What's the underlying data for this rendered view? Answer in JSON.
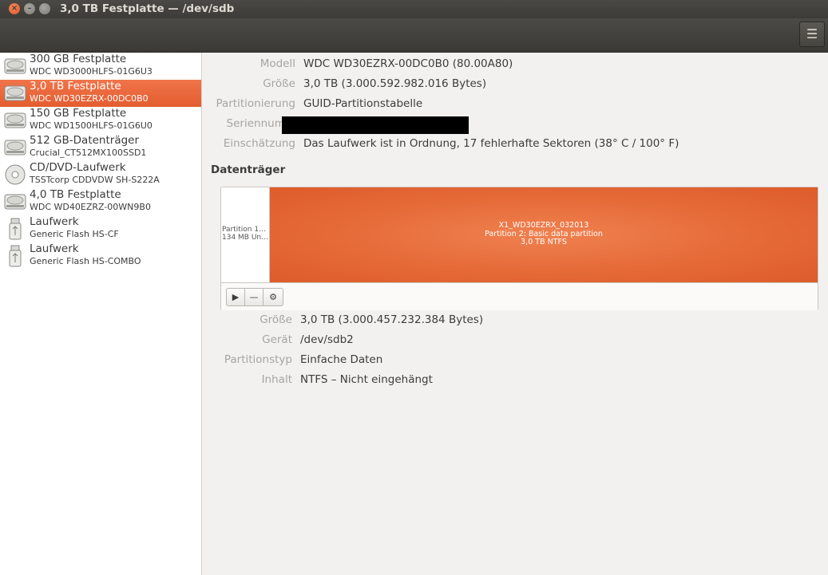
{
  "window": {
    "title": "3,0 TB Festplatte — /dev/sdb",
    "close_glyph": "×",
    "min_glyph": "–",
    "menu_glyph": "☰"
  },
  "sidebar": {
    "items": [
      {
        "name": "300 GB Festplatte",
        "model": "WDC WD3000HLFS-01G6U3",
        "icon": "hard-disk-icon"
      },
      {
        "name": "3,0 TB Festplatte",
        "model": "WDC WD30EZRX-00DC0B0",
        "icon": "hard-disk-icon"
      },
      {
        "name": "150 GB Festplatte",
        "model": "WDC WD1500HLFS-01G6U0",
        "icon": "hard-disk-icon"
      },
      {
        "name": "512 GB-Datenträger",
        "model": "Crucial_CT512MX100SSD1",
        "icon": "hard-disk-icon"
      },
      {
        "name": "CD/DVD-Laufwerk",
        "model": "TSSTcorp CDDVDW SH-S222A",
        "icon": "optical-disc-icon"
      },
      {
        "name": "4,0 TB Festplatte",
        "model": "WDC WD40EZRZ-00WN9B0",
        "icon": "hard-disk-icon"
      },
      {
        "name": "Laufwerk",
        "model": "Generic Flash HS-CF",
        "icon": "usb-drive-icon"
      },
      {
        "name": "Laufwerk",
        "model": "Generic Flash HS-COMBO",
        "icon": "usb-drive-icon"
      }
    ],
    "selected_index": 1
  },
  "drive_info": {
    "model_label": "Modell",
    "model_value": "WDC WD30EZRX-00DC0B0 (80.00A80)",
    "size_label": "Größe",
    "size_value": "3,0 TB (3.000.592.982.016 Bytes)",
    "partitioning_label": "Partitionierung",
    "partitioning_value": "GUID-Partitionstabelle",
    "serial_label": "Seriennumm",
    "assessment_label": "Einschätzung",
    "assessment_value": "Das Laufwerk ist in Ordnung, 17 fehlerhafte Sektoren (38° C / 100° F)"
  },
  "volumes": {
    "heading": "Datenträger",
    "partition1": {
      "line1": "Partition 1…",
      "line2": "134 MB Un…"
    },
    "partition2": {
      "line1": "X1_WD30EZRX_032013",
      "line2": "Partition 2: Basic data partition",
      "line3": "3,0 TB NTFS"
    },
    "buttons": {
      "mount_glyph": "▶",
      "delete_glyph": "—",
      "settings_glyph": "⚙"
    }
  },
  "partition_info": {
    "size_label": "Größe",
    "size_value": "3,0 TB (3.000.457.232.384 Bytes)",
    "device_label": "Gerät",
    "device_value": "/dev/sdb2",
    "type_label": "Partitionstyp",
    "type_value": "Einfache Daten",
    "content_label": "Inhalt",
    "content_value": "NTFS – Nicht eingehängt"
  },
  "colors": {
    "accent": "#e95420",
    "titlebar": "#3c3b37"
  }
}
